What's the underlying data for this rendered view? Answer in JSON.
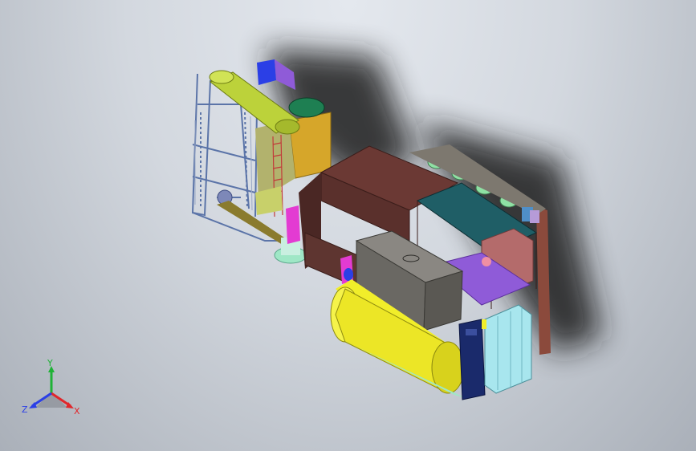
{
  "viewport": {
    "background_top": "#e4e8ee",
    "background_bottom": "#aab0b9"
  },
  "triad": {
    "x_label": "X",
    "y_label": "Y",
    "z_label": "Z",
    "x_color": "#e0262b",
    "y_color": "#1fb236",
    "z_color": "#2b3fe6"
  },
  "model": {
    "colors": {
      "frame_steel": "#5b74a8",
      "belt_housing": "#bcd23a",
      "tower_body": "#d6a62a",
      "brown_body": "#6b3934",
      "brown_dark": "#4a2724",
      "teal_top": "#1f5e66",
      "tank_yellow": "#f1ee2a",
      "motor_gray": "#6a6863",
      "cabinet_cyan": "#a8e6ee",
      "navy_box": "#1a2a6b",
      "magenta": "#e33bd2",
      "purple": "#8f5bd8",
      "salmon": "#b46b6b",
      "mint": "#9fe7c6",
      "rust_panel": "#8b4a3c"
    }
  }
}
